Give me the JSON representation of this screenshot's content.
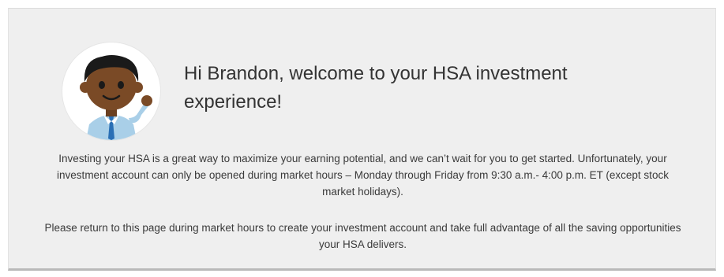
{
  "welcome_card": {
    "greeting": "Hi Brandon, welcome to your HSA investment experience!",
    "paragraph_1": "Investing your HSA is a great way to maximize your earning potential, and we can’t wait for you to get started. Unfortunately, your investment account can only be opened during market hours – Monday through Friday from 9:30 a.m.- 4:00 p.m. ET (except stock market holidays).",
    "paragraph_2": "Please return to this page during market hours to create your investment account and take full advantage of all the saving opportunities your HSA delivers.",
    "avatar_icon": "waving-man-avatar"
  },
  "colors": {
    "card_background": "#efefef",
    "text": "#333333",
    "skin": "#7a4a26",
    "hair": "#1a1a1a",
    "shirt": "#a9cfe8",
    "tie": "#2a6fb5"
  }
}
